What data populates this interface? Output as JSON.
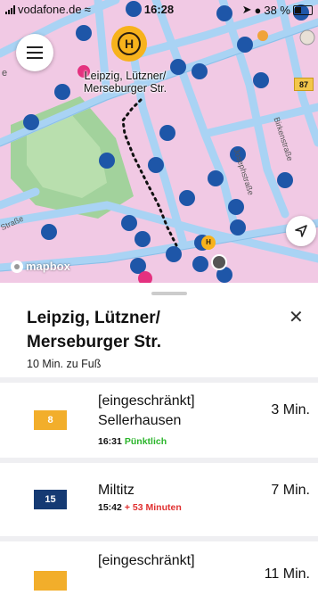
{
  "status_bar": {
    "carrier": "vodafone.de",
    "time": "16:28",
    "battery": "38 %"
  },
  "map": {
    "stop_name_line1": "Leipzig, Lützner/",
    "stop_name_line2": "Merseburger Str.",
    "stop_marker_glyph": "H",
    "small_stop_glyph": "H",
    "route_badge": "87",
    "street_labels": [
      "Birkenstraße",
      "Josephstraße",
      "Straße"
    ],
    "edge_letter": "e",
    "attribution": "mapbox",
    "colors": {
      "land": "#f1c9e4",
      "roads": "#a9d3f4",
      "bike_marker": "#1e56a8",
      "park": "#a2d29c",
      "stop_marker": "#f7b21c"
    }
  },
  "sheet": {
    "title": "Leipzig, Lützner/ Merseburger Str.",
    "walk_time": "10 Min. zu Fuß",
    "close_icon": "close-icon"
  },
  "departures": [
    {
      "line": "8",
      "color": "#f2ae2b",
      "destination": "[eingeschränkt] Sellerhausen",
      "time": "16:31",
      "status": "Pünktlich",
      "status_color": "#2bb52b",
      "minutes": "3 Min."
    },
    {
      "line": "15",
      "color": "#153a73",
      "destination": "Miltitz",
      "time": "15:42",
      "status": "+ 53 Minuten",
      "status_color": "#e03030",
      "minutes": "7 Min."
    },
    {
      "line": "",
      "color": "#f2ae2b",
      "destination": "[eingeschränkt]",
      "time": "",
      "status": "",
      "status_color": "#2bb52b",
      "minutes": "11 Min."
    }
  ]
}
